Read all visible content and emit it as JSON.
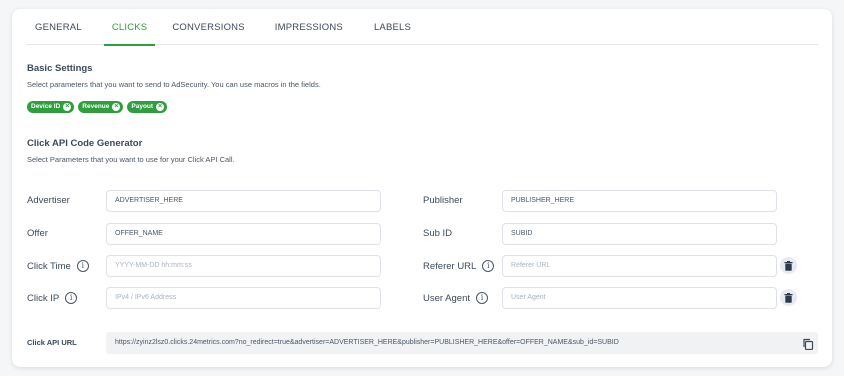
{
  "tabs": [
    {
      "label": "GENERAL",
      "active": false
    },
    {
      "label": "CLICKS",
      "active": true
    },
    {
      "label": "CONVERSIONS",
      "active": false
    },
    {
      "label": "IMPRESSIONS",
      "active": false
    },
    {
      "label": "LABELS",
      "active": false
    }
  ],
  "basic": {
    "title": "Basic Settings",
    "subtitle": "Select parameters that you want to send to AdSecurity. You can use macros in the fields.",
    "chips": [
      "Device ID",
      "Revenue",
      "Payout"
    ]
  },
  "generator": {
    "title": "Click API Code Generator",
    "subtitle": "Select Parameters that you want to use for your Click API Call."
  },
  "fields": {
    "advertiser": {
      "label": "Advertiser",
      "value": "ADVERTISER_HERE"
    },
    "publisher": {
      "label": "Publisher",
      "value": "PUBLISHER_HERE"
    },
    "offer": {
      "label": "Offer",
      "value": "OFFER_NAME"
    },
    "sub_id": {
      "label": "Sub ID",
      "value": "SUBID"
    },
    "click_time": {
      "label": "Click Time",
      "placeholder": "YYYY-MM-DD hh:mm:ss"
    },
    "referer_url": {
      "label": "Referer URL",
      "placeholder": "Referer URL"
    },
    "click_ip": {
      "label": "Click IP",
      "placeholder": "IPv4 / IPv6 Address"
    },
    "user_agent": {
      "label": "User Agent",
      "placeholder": "User Agent"
    }
  },
  "api_url": {
    "label": "Click API URL",
    "value": "https://zyinz2lsz0.clicks.24metrics.com?no_redirect=true&advertiser=ADVERTISER_HERE&publisher=PUBLISHER_HERE&offer=OFFER_NAME&sub_id=SUBID"
  },
  "colors": {
    "accent": "#2e9e3e",
    "text": "#3b4a5a",
    "border": "#dde2e8"
  }
}
